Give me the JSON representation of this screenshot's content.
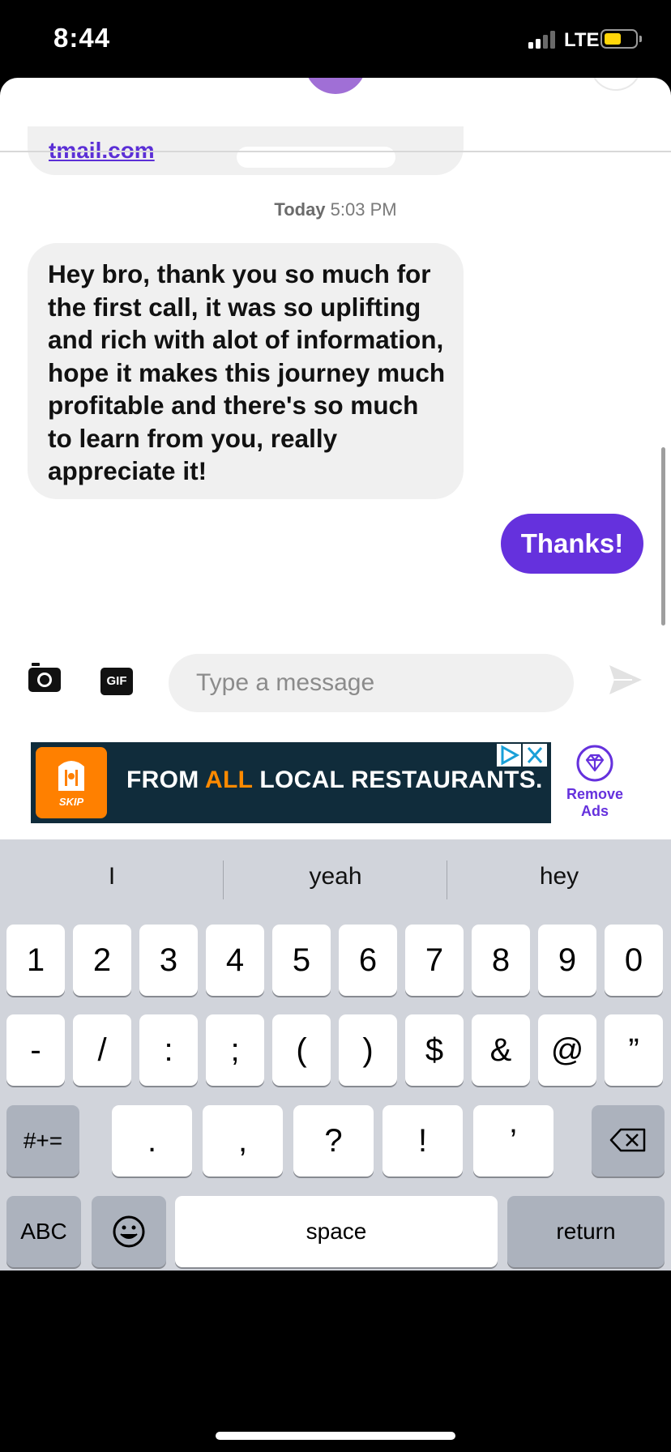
{
  "status": {
    "time": "8:44",
    "network": "LTE"
  },
  "conversation": {
    "previous_link": "tmail.com",
    "timestamp_day": "Today",
    "timestamp_time": "5:03 PM",
    "incoming_message": "Hey bro, thank you so much for the first call, it was so uplifting and rich with alot of information, hope it makes this journey much profitable and there's so much to learn from you, really appreciate it!",
    "outgoing_message": "Thanks!"
  },
  "compose": {
    "placeholder": "Type a message",
    "gif_label": "GIF",
    "camera_icon": "camera-icon",
    "send_icon": "send-icon"
  },
  "ad": {
    "logo_text": "SKIP",
    "headline_prefix": "FROM ",
    "headline_highlight": "ALL",
    "headline_suffix": " LOCAL RESTAURANTS.",
    "highlight_color": "#ff8a00",
    "remove_label": "Remove Ads"
  },
  "keyboard": {
    "suggestions": [
      "I",
      "yeah",
      "hey"
    ],
    "row1": [
      "1",
      "2",
      "3",
      "4",
      "5",
      "6",
      "7",
      "8",
      "9",
      "0"
    ],
    "row2": [
      "-",
      "/",
      ":",
      ";",
      "(",
      ")",
      "$",
      "&",
      "@",
      "”"
    ],
    "row3": [
      ".",
      ",",
      "?",
      "!",
      "’"
    ],
    "symbols_key": "#+=",
    "abc_key": "ABC",
    "space_key": "space",
    "return_key": "return"
  },
  "colors": {
    "accent": "#6531dd",
    "incoming_bubble": "#f0f0f0",
    "keyboard_bg": "#d1d4db"
  }
}
